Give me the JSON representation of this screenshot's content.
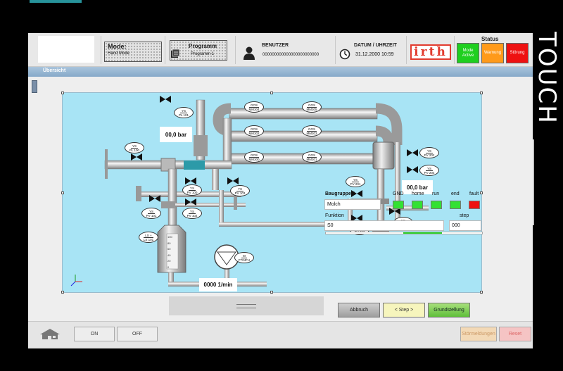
{
  "header": {
    "mode_label": "Mode:",
    "mode_value": "Hand Mode",
    "program_title": "Programm",
    "program_value": "Programm 1",
    "user_label": "BENUTZER",
    "user_value": "000000000000000000000000",
    "datetime_label": "DATUM / UHRZEIT",
    "datetime_value": "31.12.2000 10:59",
    "logo_text": "irth",
    "status_title": "Status",
    "status_buttons": [
      {
        "label": "Mode Active",
        "color": "#1fcf1f"
      },
      {
        "label": "Warnung",
        "color": "#ff9a1a"
      },
      {
        "label": "Störung",
        "color": "#ee1111"
      }
    ]
  },
  "side_text": "TOUCH",
  "overview_tab": "Übersicht",
  "process": {
    "pressure_1": "00,0 bar",
    "pressure_2": "00,0 bar",
    "speed": "0000 1/min",
    "tags": {
      "pl101": {
        "top": "YS",
        "bottom": "PL 101"
      },
      "pl100": {
        "top": "YS",
        "bottom": "PL 100"
      },
      "pv100": {
        "top": "YS",
        "bottom": "PV 100"
      },
      "pv103": {
        "top": "YS",
        "bottom": "PV 103"
      },
      "pv101": {
        "top": "YS",
        "bottom": "PV 101"
      },
      "pv102": {
        "top": "YS",
        "bottom": "PV 102"
      },
      "ls101": {
        "top": "LS +",
        "bottom": "LS 101"
      },
      "ft04fu": {
        "top": "M",
        "bottom": "FT04FU"
      },
      "pv202": {
        "top": "YS",
        "bottom": "PV 202"
      },
      "pv204": {
        "top": "YS",
        "bottom": "PV 204"
      },
      "pv201": {
        "top": "YS",
        "bottom": "PV 201"
      },
      "pv203": {
        "top": "YS",
        "bottom": "PV 203"
      },
      "pv200": {
        "top": "YS",
        "bottom": "PV 200"
      },
      "mm304": {
        "top": "GOS",
        "bottom": "MM304"
      },
      "mm305": {
        "top": "GOS",
        "bottom": "MM305"
      },
      "mm302": {
        "top": "GOS",
        "bottom": "MM302"
      },
      "mm303": {
        "top": "GOS",
        "bottom": "MM303"
      },
      "mm300": {
        "top": "GOS",
        "bottom": "MM300"
      },
      "mm301": {
        "top": "GOS",
        "bottom": "MM301"
      }
    },
    "tank_scale": [
      "100",
      "80",
      "60",
      "40",
      "20",
      "0"
    ]
  },
  "baugruppe": {
    "title": "Baugruppe 1",
    "name": "Molch",
    "function_label": "Funktion",
    "function_value": "S0",
    "step_label": "step",
    "step_value": "000",
    "leds": [
      {
        "label": "GND",
        "color": "#33e133"
      },
      {
        "label": "home",
        "color": "#33e133"
      },
      {
        "label": "run",
        "color": "#33e133"
      },
      {
        "label": "end",
        "color": "#33e133"
      },
      {
        "label": "fault",
        "color": "#ee1111"
      }
    ],
    "progress": 0.5
  },
  "actions": {
    "abbruch": "Abbruch",
    "step": "< Step >",
    "grundstellung": "Grundstellung"
  },
  "footer": {
    "on": "ON",
    "off": "OFF",
    "stoermeldungen": "Störmeldungen",
    "reset": "Reset"
  }
}
